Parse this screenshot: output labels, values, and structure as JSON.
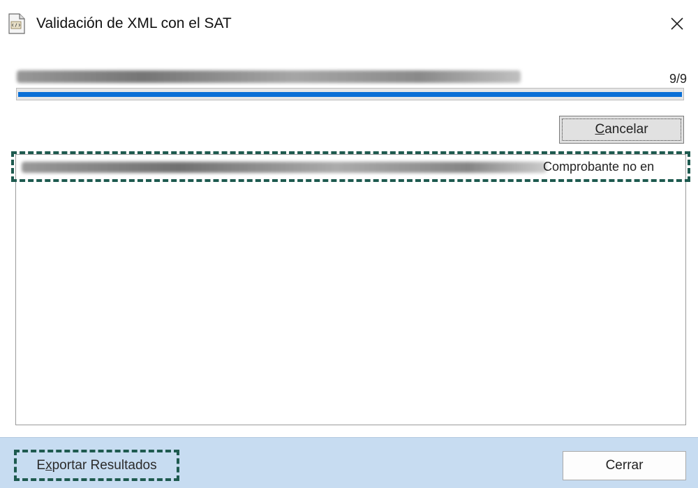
{
  "window": {
    "title": "Validación de XML con el SAT",
    "app_icon": "xml-document-icon",
    "close_icon": "close-icon"
  },
  "progress": {
    "counter": "9/9",
    "fraction": 1.0,
    "fill_color": "#0a6fd6"
  },
  "buttons": {
    "cancel_mnemonic": "C",
    "cancel_rest": "ancelar",
    "export_first": "E",
    "export_mnemonic": "x",
    "export_rest": "portar Resultados",
    "close_label": "Cerrar"
  },
  "results": {
    "rows": [
      {
        "status_text": "Comprobante no en"
      }
    ]
  },
  "colors": {
    "footer_bg": "#c7dcf1",
    "focus_outline": "#1e5a4f"
  }
}
